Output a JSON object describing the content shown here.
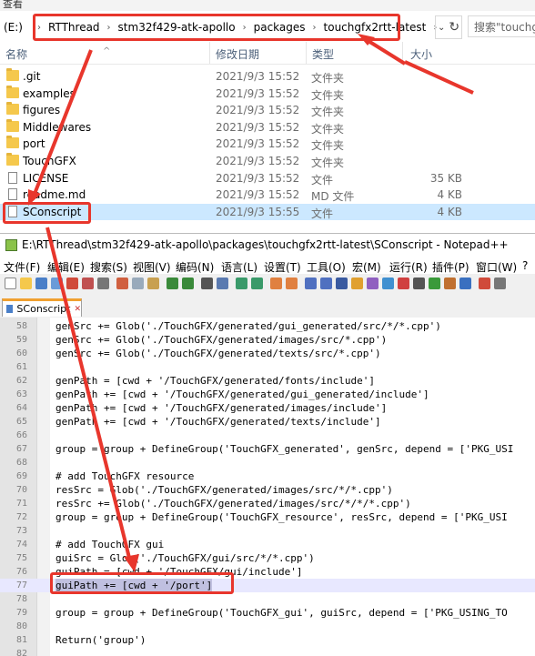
{
  "explorer": {
    "top_text": "查看",
    "drive_label": "(E:)",
    "path": [
      "RTThread",
      "stm32f429-atk-apollo",
      "packages",
      "touchgfx2rtt-latest"
    ],
    "search_placeholder": "搜索\"touchgfx",
    "columns": {
      "name": "名称",
      "date": "修改日期",
      "type": "类型",
      "size": "大小"
    },
    "files": [
      {
        "name": ".git",
        "date": "2021/9/3 15:52",
        "type": "文件夹",
        "size": "",
        "kind": "folder"
      },
      {
        "name": "examples",
        "date": "2021/9/3 15:52",
        "type": "文件夹",
        "size": "",
        "kind": "folder"
      },
      {
        "name": "figures",
        "date": "2021/9/3 15:52",
        "type": "文件夹",
        "size": "",
        "kind": "folder"
      },
      {
        "name": "Middlewares",
        "date": "2021/9/3 15:52",
        "type": "文件夹",
        "size": "",
        "kind": "folder"
      },
      {
        "name": "port",
        "date": "2021/9/3 15:52",
        "type": "文件夹",
        "size": "",
        "kind": "folder"
      },
      {
        "name": "TouchGFX",
        "date": "2021/9/3 15:52",
        "type": "文件夹",
        "size": "",
        "kind": "folder"
      },
      {
        "name": "LICENSE",
        "date": "2021/9/3 15:52",
        "type": "文件",
        "size": "35 KB",
        "kind": "file"
      },
      {
        "name": "readme.md",
        "date": "2021/9/3 15:52",
        "type": "MD 文件",
        "size": "4 KB",
        "kind": "file"
      },
      {
        "name": "SConscript",
        "date": "2021/9/3 15:55",
        "type": "文件",
        "size": "4 KB",
        "kind": "file"
      }
    ]
  },
  "notepad": {
    "title": "E:\\RTThread\\stm32f429-atk-apollo\\packages\\touchgfx2rtt-latest\\SConscript - Notepad++",
    "menu": [
      "文件(F)",
      "编辑(E)",
      "搜索(S)",
      "视图(V)",
      "编码(N)",
      "语言(L)",
      "设置(T)",
      "工具(O)",
      "宏(M)",
      "运行(R)",
      "插件(P)",
      "窗口(W)",
      "?"
    ],
    "tab_label": "SConscript",
    "lines": [
      {
        "n": "58",
        "t": "genSrc += Glob('./TouchGFX/generated/gui_generated/src/*/*.cpp')"
      },
      {
        "n": "59",
        "t": "genSrc += Glob('./TouchGFX/generated/images/src/*.cpp')"
      },
      {
        "n": "60",
        "t": "genSrc += Glob('./TouchGFX/generated/texts/src/*.cpp')"
      },
      {
        "n": "61",
        "t": ""
      },
      {
        "n": "62",
        "t": "genPath = [cwd + '/TouchGFX/generated/fonts/include']"
      },
      {
        "n": "63",
        "t": "genPath += [cwd + '/TouchGFX/generated/gui_generated/include']"
      },
      {
        "n": "64",
        "t": "genPath += [cwd + '/TouchGFX/generated/images/include']"
      },
      {
        "n": "65",
        "t": "genPath += [cwd + '/TouchGFX/generated/texts/include']"
      },
      {
        "n": "66",
        "t": ""
      },
      {
        "n": "67",
        "t": "group = group + DefineGroup('TouchGFX_generated', genSrc, depend = ['PKG_USI"
      },
      {
        "n": "68",
        "t": ""
      },
      {
        "n": "69",
        "t": "# add TouchGFX resource"
      },
      {
        "n": "70",
        "t": "resSrc = Glob('./TouchGFX/generated/images/src/*/*.cpp')"
      },
      {
        "n": "71",
        "t": "resSrc += Glob('./TouchGFX/generated/images/src/*/*/*.cpp')"
      },
      {
        "n": "72",
        "t": "group = group + DefineGroup('TouchGFX_resource', resSrc, depend = ['PKG_USI"
      },
      {
        "n": "73",
        "t": ""
      },
      {
        "n": "74",
        "t": "# add TouchGFX gui"
      },
      {
        "n": "75",
        "t": "guiSrc = Glob('./TouchGFX/gui/src/*/*.cpp')"
      },
      {
        "n": "76",
        "t": "guiPath = [cwd + '/TouchGFX/gui/include']"
      },
      {
        "n": "77",
        "t": "guiPath += [cwd + '/port']"
      },
      {
        "n": "78",
        "t": ""
      },
      {
        "n": "79",
        "t": "group = group + DefineGroup('TouchGFX_gui', guiSrc, depend = ['PKG_USING_TO"
      },
      {
        "n": "80",
        "t": ""
      },
      {
        "n": "81",
        "t": "Return('group')"
      },
      {
        "n": "82",
        "t": ""
      }
    ]
  },
  "colors": {
    "annotation": "#e8362c",
    "selection": "#cce8ff",
    "folder": "#f5c84c"
  }
}
